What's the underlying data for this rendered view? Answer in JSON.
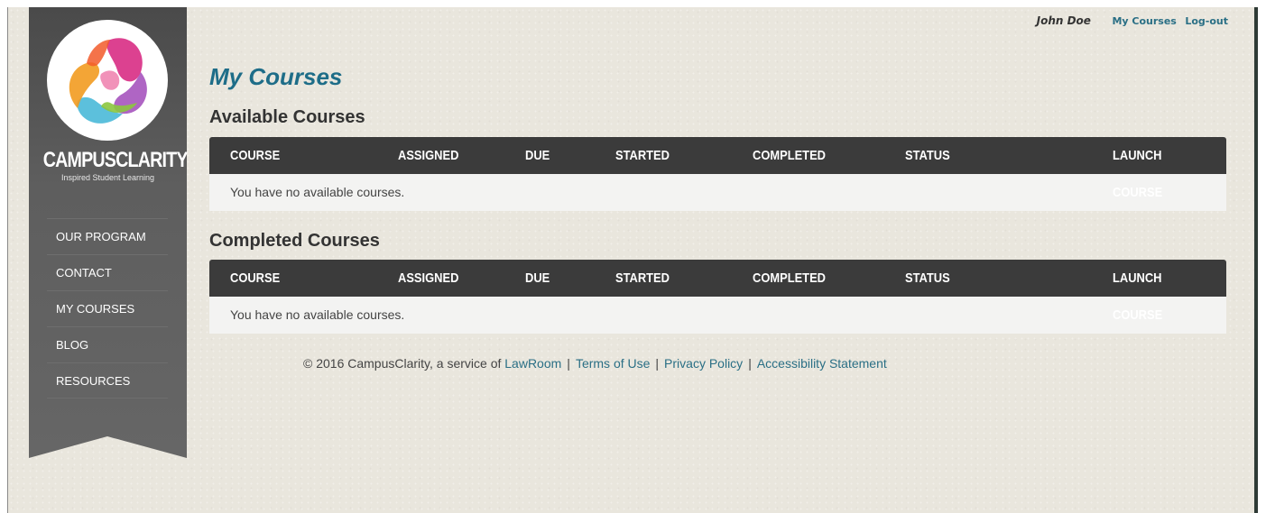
{
  "header": {
    "user_name": "John Doe",
    "my_courses_link": "My Courses",
    "logout_link": "Log-out"
  },
  "sidebar": {
    "brand": "CAMPUSCLARITY",
    "tagline": "Inspired Student Learning",
    "items": [
      {
        "label": "OUR PROGRAM"
      },
      {
        "label": "CONTACT"
      },
      {
        "label": "MY COURSES"
      },
      {
        "label": "BLOG"
      },
      {
        "label": "RESOURCES"
      }
    ]
  },
  "main": {
    "title": "My Courses",
    "available": {
      "heading": "Available Courses",
      "columns": [
        "COURSE",
        "ASSIGNED",
        "DUE",
        "STARTED",
        "COMPLETED",
        "STATUS",
        "LAUNCH COURSE"
      ],
      "empty_message": "You have no available courses."
    },
    "completed": {
      "heading": "Completed Courses",
      "columns": [
        "COURSE",
        "ASSIGNED",
        "DUE",
        "STARTED",
        "COMPLETED",
        "STATUS",
        "LAUNCH COURSE"
      ],
      "empty_message": "You have no available courses."
    }
  },
  "footer": {
    "copyright": "© 2016 CampusClarity, a service of",
    "lawroom": "LawRoom",
    "terms": "Terms of Use",
    "privacy": "Privacy Policy",
    "accessibility": "Accessibility Statement"
  },
  "colors": {
    "accent": "#1e6d88",
    "link": "#2a6f85",
    "sidebar": "#5a5a5a",
    "table_header": "#3b3b3b"
  }
}
